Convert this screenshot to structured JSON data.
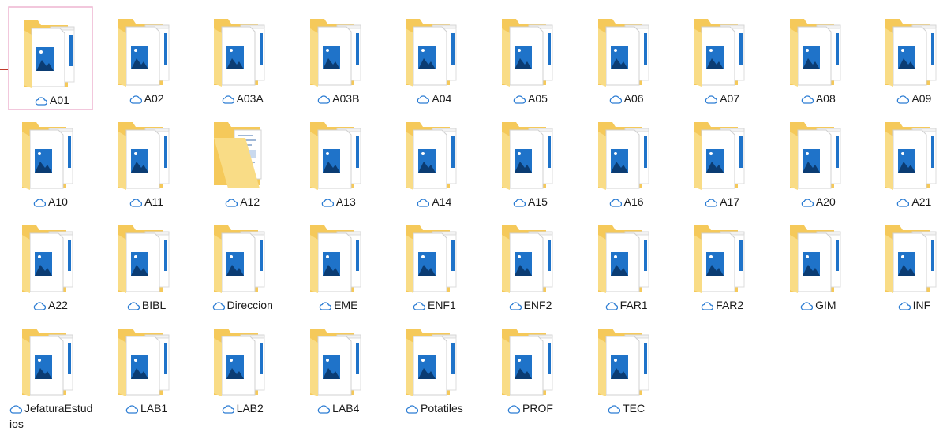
{
  "colors": {
    "folder_back": "#f5c95a",
    "folder_front": "#f9dc86",
    "image_blue": "#1f73c9",
    "cloud_blue": "#2b7cd3",
    "selection": "#f2c7dc"
  },
  "folders": [
    {
      "name": "A01",
      "selected": true,
      "preview": "image"
    },
    {
      "name": "A02",
      "preview": "image"
    },
    {
      "name": "A03A",
      "preview": "image"
    },
    {
      "name": "A03B",
      "preview": "image"
    },
    {
      "name": "A04",
      "preview": "image"
    },
    {
      "name": "A05",
      "preview": "image"
    },
    {
      "name": "A06",
      "preview": "image"
    },
    {
      "name": "A07",
      "preview": "image"
    },
    {
      "name": "A08",
      "preview": "image"
    },
    {
      "name": "A09",
      "preview": "image"
    },
    {
      "name": "A10",
      "preview": "image"
    },
    {
      "name": "A11",
      "preview": "image"
    },
    {
      "name": "A12",
      "preview": "document"
    },
    {
      "name": "A13",
      "preview": "image"
    },
    {
      "name": "A14",
      "preview": "image"
    },
    {
      "name": "A15",
      "preview": "image"
    },
    {
      "name": "A16",
      "preview": "image"
    },
    {
      "name": "A17",
      "preview": "image"
    },
    {
      "name": "A20",
      "preview": "image"
    },
    {
      "name": "A21",
      "preview": "image"
    },
    {
      "name": "A22",
      "preview": "image"
    },
    {
      "name": "BIBL",
      "preview": "image"
    },
    {
      "name": "Direccion",
      "preview": "image"
    },
    {
      "name": "EME",
      "preview": "image"
    },
    {
      "name": "ENF1",
      "preview": "image"
    },
    {
      "name": "ENF2",
      "preview": "image"
    },
    {
      "name": "FAR1",
      "preview": "image"
    },
    {
      "name": "FAR2",
      "preview": "image"
    },
    {
      "name": "GIM",
      "preview": "image"
    },
    {
      "name": "INF",
      "preview": "image"
    },
    {
      "name": "JefaturaEstudios",
      "preview": "image"
    },
    {
      "name": "LAB1",
      "preview": "image"
    },
    {
      "name": "LAB2",
      "preview": "image"
    },
    {
      "name": "LAB4",
      "preview": "image"
    },
    {
      "name": "Potatiles",
      "preview": "image"
    },
    {
      "name": "PROF",
      "preview": "image"
    },
    {
      "name": "TEC",
      "preview": "image"
    }
  ]
}
